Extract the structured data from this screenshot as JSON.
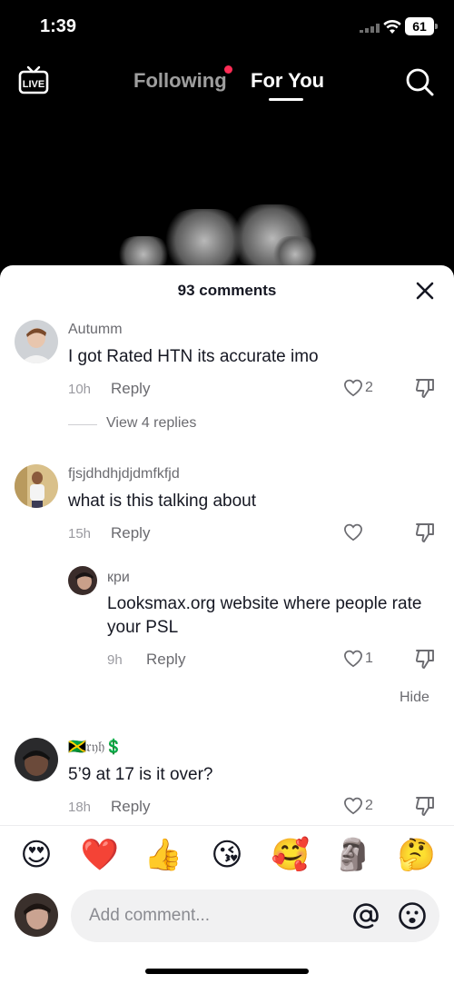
{
  "status_bar": {
    "time": "1:39",
    "battery": "61"
  },
  "top_nav": {
    "live_label": "LIVE",
    "tabs": [
      {
        "label": "Following",
        "active": false
      },
      {
        "label": "For You",
        "active": true
      }
    ],
    "icons": {
      "live": "live-tv-icon",
      "search": "search-icon"
    }
  },
  "comments_sheet": {
    "title": "93 comments",
    "comments": [
      {
        "username": "Autumm",
        "text": "I got Rated HTN its accurate imo",
        "time": "10h",
        "reply_label": "Reply",
        "likes": "2",
        "view_replies": "View 4 replies"
      },
      {
        "username": "fjsjdhdhjdjdmfkfjd",
        "text": "what is this talking about",
        "time": "15h",
        "reply_label": "Reply",
        "likes": ""
      },
      {
        "username": "кри",
        "text": "Looksmax.org website where people rate your PSL",
        "time": "9h",
        "reply_label": "Reply",
        "likes": "1",
        "is_reply": true
      },
      {
        "username": "🇯🇲𝔯𝔶𝔥💲",
        "text": "5’9 at 17 is it over?",
        "time": "18h",
        "reply_label": "Reply",
        "likes": "2"
      }
    ],
    "hide_label": "Hide"
  },
  "emoji_bar": [
    "😍",
    "❤️",
    "👍",
    "😘",
    "🥰",
    "🗿",
    "🤔"
  ],
  "input_bar": {
    "placeholder": "Add comment..."
  },
  "colors": {
    "accent": "#fe2c55",
    "text_primary": "#161823",
    "text_secondary": "#6b6b70"
  }
}
